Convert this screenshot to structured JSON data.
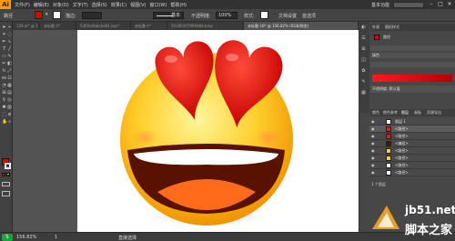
{
  "app": {
    "logo": "Ai"
  },
  "menu": {
    "items": [
      "文件(F)",
      "编辑(E)",
      "对象(O)",
      "文字(T)",
      "选择(S)",
      "效果(C)",
      "视图(V)",
      "窗口(W)",
      "帮助(H)"
    ],
    "workspace_label": "基本功能",
    "minimize": "–",
    "maximize": "□",
    "close": "✕"
  },
  "control": {
    "type_label": "路径",
    "stroke_label": "描边:",
    "stroke_style": "基本",
    "opacity_label": "不透明度:",
    "opacity_value": "100%",
    "style_label": "样式:",
    "doc_setup": "文档设置",
    "prefs": "首选项"
  },
  "tabs": [
    {
      "label": "128.ai* @ 1",
      "active": false
    },
    {
      "label": "未标题-1*",
      "active": false
    },
    {
      "label": "5365d2bbcbd61.eps*",
      "active": false
    },
    {
      "label": "未标题-1*",
      "active": false
    },
    {
      "label": "20180107909488.bmp",
      "active": false
    },
    {
      "label": "未标题-16* @ 156.82% (RGB/预览)",
      "active": true
    }
  ],
  "status": {
    "zoom": "156.82%",
    "artboard": "1",
    "mode": "直接选择"
  },
  "panels": {
    "appearance_tabs": [
      "外观",
      "图形样式"
    ],
    "appearance_type": "路径",
    "appearance_fill": "填色",
    "appearance_opacity": "不透明度: 默认值",
    "layers_tabs": [
      "颜色",
      "颜色参考",
      "图层",
      "画板",
      "资源导出"
    ],
    "layers": [
      {
        "name": "图层 1",
        "selected": false
      },
      {
        "name": "<路径>",
        "selected": true
      },
      {
        "name": "<路径>",
        "selected": false
      },
      {
        "name": "<编组>",
        "selected": false
      },
      {
        "name": "<路径>",
        "selected": false
      },
      {
        "name": "<路径>",
        "selected": false
      },
      {
        "name": "<路径>",
        "selected": false
      },
      {
        "name": "<路径>",
        "selected": false
      }
    ],
    "layers_count": "1 个图层"
  },
  "watermark": {
    "brand": "jb51.net",
    "tagline": "脚本之家"
  },
  "colors": {
    "fill": "#e00000",
    "accent": "#ff9a00",
    "heart": "#e31b1b",
    "face": "#ffd02a"
  }
}
